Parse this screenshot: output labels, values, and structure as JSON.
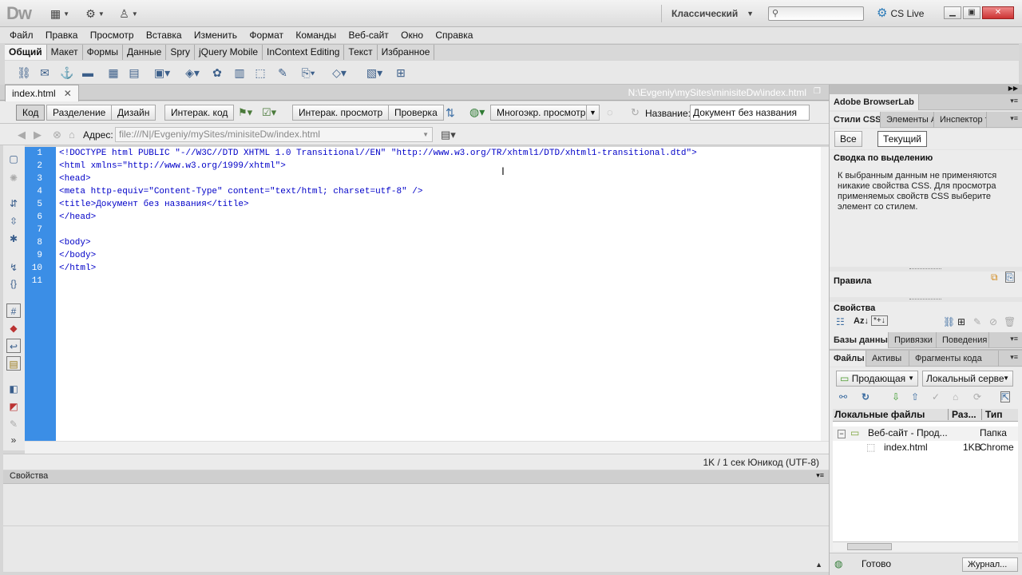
{
  "app": {
    "logo": "Dw",
    "workspace": "Классический",
    "search_placeholder": "",
    "cs_live": "CS Live"
  },
  "menu": [
    "Файл",
    "Правка",
    "Просмотр",
    "Вставка",
    "Изменить",
    "Формат",
    "Команды",
    "Веб-сайт",
    "Окно",
    "Справка"
  ],
  "insert_tabs": [
    "Общий",
    "Макет",
    "Формы",
    "Данные",
    "Spry",
    "jQuery Mobile",
    "InContext Editing",
    "Текст",
    "Избранное"
  ],
  "document": {
    "tab_name": "index.html",
    "path": "N:\\Evgeniy\\mySites\\minisiteDw\\index.html",
    "view_buttons": {
      "code": "Код",
      "split": "Разделение",
      "design": "Дизайн",
      "live_code": "Интерак. код",
      "live_view": "Интерак. просмотр",
      "inspect": "Проверка",
      "multiscreen": "Многоэкр. просмотр"
    },
    "title_label": "Название:",
    "title_value": "Документ без названия",
    "address_label": "Адрес:",
    "address_value": "file:///N|/Evgeniy/mySites/minisiteDw/index.html",
    "code_lines": [
      "<!DOCTYPE html PUBLIC \"-//W3C//DTD XHTML 1.0 Transitional//EN\" \"http://www.w3.org/TR/xhtml1/DTD/xhtml1-transitional.dtd\">",
      "<html xmlns=\"http://www.w3.org/1999/xhtml\">",
      "<head>",
      "<meta http-equiv=\"Content-Type\" content=\"text/html; charset=utf-8\" />",
      "<title>Документ без названия</title>",
      "</head>",
      "",
      "<body>",
      "</body>",
      "</html>",
      ""
    ],
    "line_numbers": [
      "1",
      "2",
      "3",
      "4",
      "5",
      "6",
      "7",
      "8",
      "9",
      "10",
      "11"
    ],
    "status": "1K / 1 сек  Юникод (UTF-8)",
    "properties_title": "Свойства"
  },
  "right_panel": {
    "browserlab": "Adobe BrowserLab",
    "css_tabs": [
      "Стили CSS",
      "Элементы А",
      "Инспектор т"
    ],
    "css_buttons": {
      "all": "Все",
      "current": "Текущий"
    },
    "summary_title": "Сводка по выделению",
    "summary_text": "К выбранным данным не применяются никакие свойства CSS.  Для просмотра применяемых свойств CSS выберите элемент со стилем.",
    "rules_title": "Правила",
    "props_title": "Свойства",
    "db_tabs": [
      "Базы данных",
      "Привязки",
      "Поведения"
    ],
    "files_tabs": [
      "Файлы",
      "Активы",
      "Фрагменты кода"
    ],
    "site_select": "Продающая",
    "server_select": "Локальный серве",
    "files_columns": [
      "Локальные файлы",
      "Раз...",
      "Тип"
    ],
    "files_rows": [
      {
        "name": "Веб-сайт - Прод...",
        "size": "",
        "type": "Папка"
      },
      {
        "name": "index.html",
        "size": "1KB",
        "type": "Chrome"
      }
    ],
    "status": "Готово",
    "journal": "Журнал..."
  }
}
